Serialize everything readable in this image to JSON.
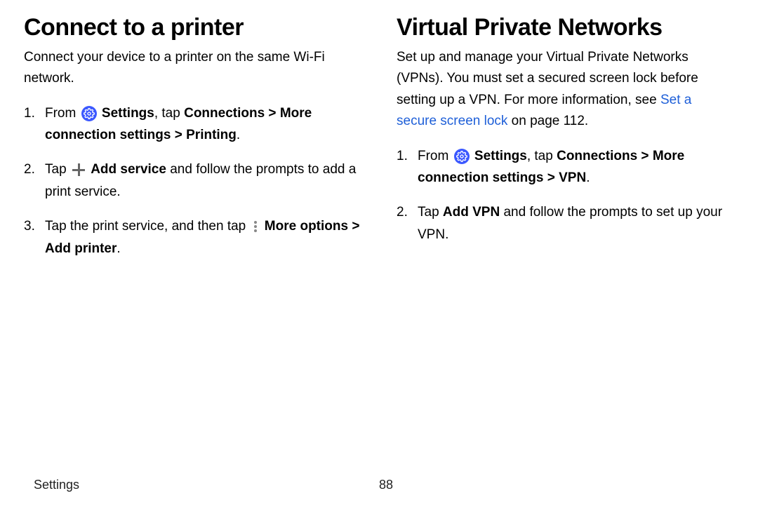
{
  "left": {
    "title": "Connect to a printer",
    "intro": "Connect your device to a printer on the same Wi-Fi network.",
    "step1": {
      "t1": "From ",
      "b1": "Settings",
      "t2": ", tap ",
      "b2": "Connections",
      "sep1": " > ",
      "b3": "More connection settings",
      "sep2": " > ",
      "b4": "Printing",
      "t3": "."
    },
    "step2": {
      "t1": "Tap ",
      "b1": "Add service",
      "t2": " and follow the prompts to add a print service."
    },
    "step3": {
      "t1": "Tap the print service, and then tap ",
      "b1": "More options",
      "sep1": " > ",
      "b2": "Add printer",
      "t2": "."
    }
  },
  "right": {
    "title": "Virtual Private Networks",
    "intro": {
      "t1": "Set up and manage your Virtual Private Networks (VPNs). You must set a secured screen lock before setting up a VPN. For more information, see ",
      "link": "Set a secure screen lock",
      "t2": " on page 112."
    },
    "step1": {
      "t1": "From ",
      "b1": "Settings",
      "t2": ", tap ",
      "b2": "Connections",
      "sep1": " > ",
      "b3": "More connection settings",
      "sep2": " > ",
      "b4": "VPN",
      "t3": "."
    },
    "step2": {
      "t1": "Tap ",
      "b1": "Add VPN",
      "t2": " and follow the prompts to set up your VPN."
    }
  },
  "footer": {
    "section": "Settings",
    "page": "88"
  }
}
